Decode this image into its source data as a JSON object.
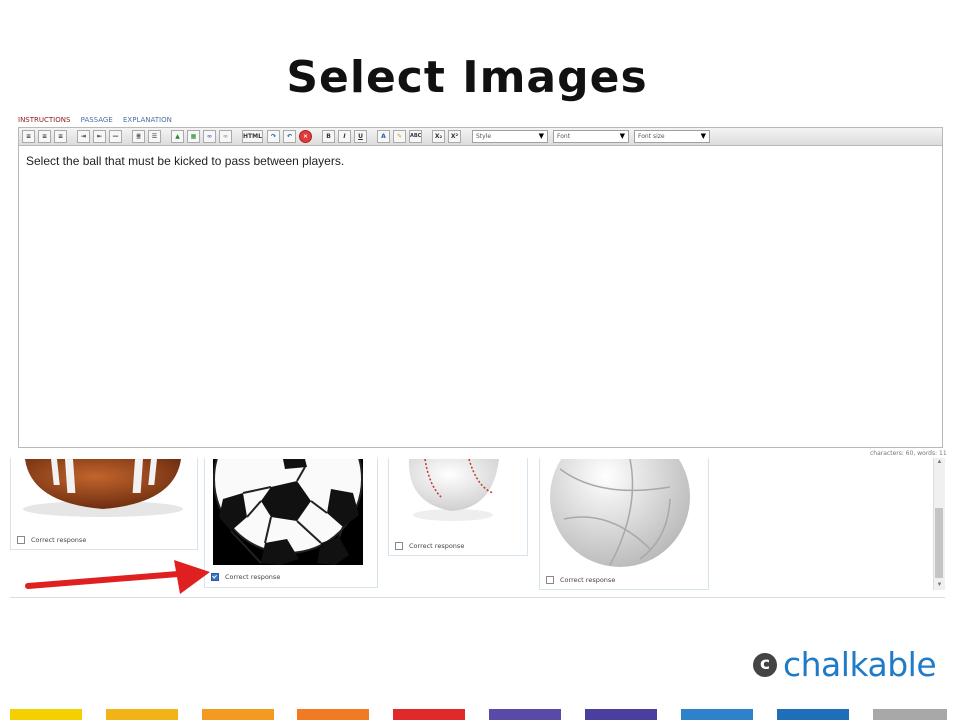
{
  "slide": {
    "title": "Select Images"
  },
  "editor": {
    "tabs": [
      {
        "label": "INSTRUCTIONS",
        "active": true
      },
      {
        "label": "PASSAGE",
        "active": false
      },
      {
        "label": "EXPLANATION",
        "active": false
      }
    ],
    "toolbar": {
      "html_label": "HTML",
      "bold_label": "B",
      "italic_label": "I",
      "underline_label": "U",
      "font_color_label": "A",
      "spellcheck_label": "ABC",
      "subscript_label": "X₂",
      "superscript_label": "X²",
      "style_select": "Style",
      "font_select": "Font",
      "size_select": "Font size"
    },
    "content": "Select the ball that must be kicked to pass between players.",
    "status": "characters: 60, words: 11"
  },
  "choices": [
    {
      "image": "american-football",
      "label": "Correct response",
      "checked": false
    },
    {
      "image": "soccer-ball",
      "label": "Correct response",
      "checked": true
    },
    {
      "image": "baseball",
      "label": "Correct response",
      "checked": false
    },
    {
      "image": "volleyball",
      "label": "Correct response",
      "checked": false
    }
  ],
  "logo": {
    "mark": "c",
    "text": "chalkable"
  },
  "colors": {
    "accent": "#1f7bc7",
    "arrow": "#e02020",
    "checkbox_checked": "#3b74c9",
    "strip": [
      "#f5d000",
      "#f2b318",
      "#f29a22",
      "#f07b22",
      "#e02a2a",
      "#5a4aa8",
      "#4a3f9e",
      "#2f82c9",
      "#1e6fb8",
      "#a8a8a8"
    ]
  }
}
